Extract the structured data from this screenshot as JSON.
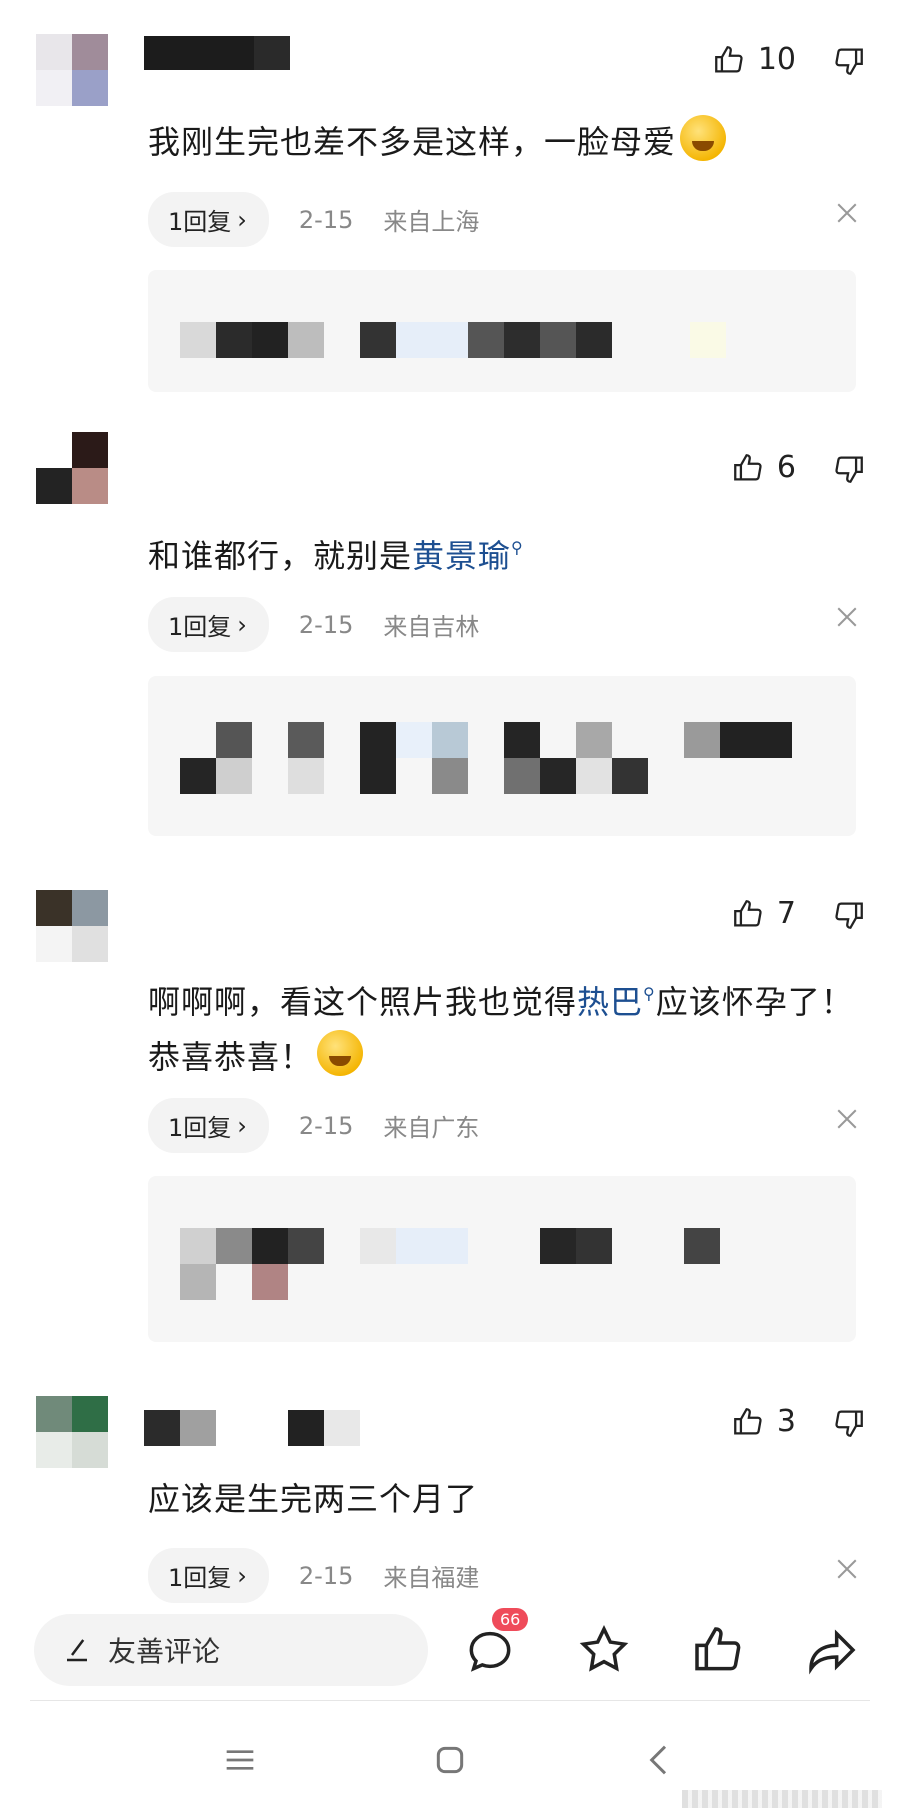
{
  "comments": [
    {
      "likes": "10",
      "text": "我刚生完也差不多是这样，一脸母爱",
      "reply_label": "1回复",
      "date": "2-15",
      "location": "来自上海"
    },
    {
      "likes": "6",
      "text_before": "和谁都行，就别是",
      "topic": "黄景瑜",
      "reply_label": "1回复",
      "date": "2-15",
      "location": "来自吉林"
    },
    {
      "likes": "7",
      "text_before": "啊啊啊，看这个照片我也觉得",
      "topic": "热巴",
      "text_after": "应该怀孕了！恭喜恭喜！",
      "reply_label": "1回复",
      "date": "2-15",
      "location": "来自广东"
    },
    {
      "likes": "3",
      "text": "应该是生完两三个月了",
      "reply_label": "1回复",
      "date": "2-15",
      "location": "来自福建"
    }
  ],
  "bottom_bar": {
    "input_placeholder": "友善评论",
    "comment_count": "66"
  },
  "icons": {
    "like": "thumbs-up-icon",
    "dislike": "thumbs-down-icon",
    "close": "close-icon",
    "comment": "comment-bubble-icon",
    "favorite": "star-icon",
    "share": "share-arrow-icon",
    "edit": "pencil-icon"
  },
  "colors": {
    "topic_link": "#1d4f91",
    "badge": "#ef4b5a"
  }
}
